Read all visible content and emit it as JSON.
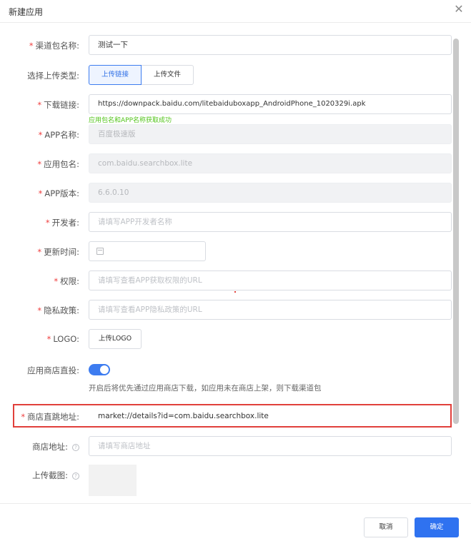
{
  "dialog": {
    "title": "新建应用"
  },
  "form": {
    "channel_name": {
      "label": "渠道包名称:",
      "value": "测试一下"
    },
    "upload_type": {
      "label": "选择上传类型:",
      "options": [
        "上传链接",
        "上传文件"
      ],
      "selected": "上传链接"
    },
    "download_link": {
      "label": "下载链接:",
      "value": "https://downpack.baidu.com/litebaiduboxapp_AndroidPhone_1020329i.apk",
      "success_text": "应用包名和APP名称获取成功"
    },
    "app_name": {
      "label": "APP名称:",
      "value": "百度极速版"
    },
    "package_name": {
      "label": "应用包名:",
      "value": "com.baidu.searchbox.lite"
    },
    "app_version": {
      "label": "APP版本:",
      "value": "6.6.0.10"
    },
    "developer": {
      "label": "开发者:",
      "placeholder": "请填写APP开发者名称"
    },
    "update_time": {
      "label": "更新时间:"
    },
    "permission": {
      "label": "权限:",
      "placeholder": "请填写查看APP获取权限的URL"
    },
    "privacy": {
      "label": "隐私政策:",
      "placeholder": "请填写查看APP隐私政策的URL"
    },
    "logo": {
      "label": "LOGO:",
      "button": "上传LOGO"
    },
    "store_direct": {
      "label": "应用商店直投:",
      "enabled": true,
      "hint": "开启后将优先通过应用商店下载，如应用未在商店上架，则下载渠道包"
    },
    "store_jump_url": {
      "label": "商店直跳地址:",
      "value": "market://details?id=com.baidu.searchbox.lite"
    },
    "store_url": {
      "label": "商店地址:",
      "placeholder": "请填写商店地址"
    },
    "screenshot": {
      "label": "上传截图:"
    }
  },
  "footer": {
    "cancel_label": "取消",
    "ok_label": "确定"
  },
  "colors": {
    "primary": "#2f72f0",
    "required": "#ef3e3e",
    "success": "#52c41a",
    "highlight": "#e1403b"
  }
}
